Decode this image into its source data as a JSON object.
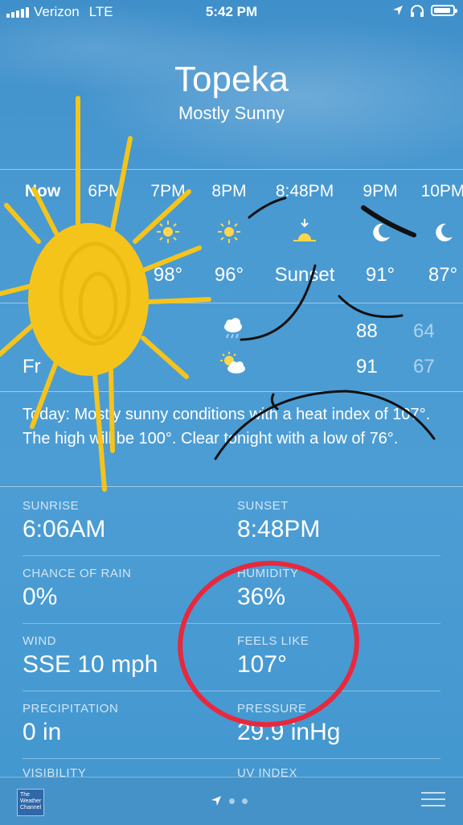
{
  "status_bar": {
    "carrier": "Verizon",
    "network": "LTE",
    "time": "5:42 PM"
  },
  "header": {
    "city": "Topeka",
    "condition": "Mostly Sunny"
  },
  "hourly": [
    {
      "label": "Now",
      "icon": "sun-icon",
      "temp": ""
    },
    {
      "label": "6PM",
      "icon": "sun-icon",
      "temp": ""
    },
    {
      "label": "7PM",
      "icon": "sun-icon",
      "temp": "98°"
    },
    {
      "label": "8PM",
      "icon": "sun-icon",
      "temp": "96°"
    },
    {
      "label": "8:48PM",
      "icon": "sunset-icon",
      "temp": "Sunset"
    },
    {
      "label": "9PM",
      "icon": "moon-icon",
      "temp": "91°"
    },
    {
      "label": "10PM",
      "icon": "moon-icon",
      "temp": "87°"
    }
  ],
  "daily": [
    {
      "name": "",
      "icon": "rain-cloud-icon",
      "high": "88",
      "low": "64"
    },
    {
      "name": "Fr",
      "icon": "partly-cloudy-icon",
      "high": "91",
      "low": "67"
    }
  ],
  "summary": "Today: Mostly sunny conditions with a heat index of 107°. The high will be 100°. Clear tonight with a low of 76°.",
  "details": {
    "sunrise_label": "SUNRISE",
    "sunrise_value": "6:06AM",
    "sunset_label": "SUNSET",
    "sunset_value": "8:48PM",
    "rain_label": "CHANCE OF RAIN",
    "rain_value": "0%",
    "humidity_label": "HUMIDITY",
    "humidity_value": "36%",
    "wind_label": "WIND",
    "wind_value": "SSE 10 mph",
    "feels_label": "FEELS LIKE",
    "feels_value": "107°",
    "precip_label": "PRECIPITATION",
    "precip_value": "0 in",
    "pressure_label": "PRESSURE",
    "pressure_value": "29.9 inHg",
    "visibility_label": "VISIBILITY",
    "uv_label": "UV INDEX"
  },
  "bottom_bar": {
    "logo_text": "The Weather Channel"
  },
  "colors": {
    "sun_doodle": "#f5c41b",
    "circle": "#e8283d",
    "ink": "#111111"
  }
}
